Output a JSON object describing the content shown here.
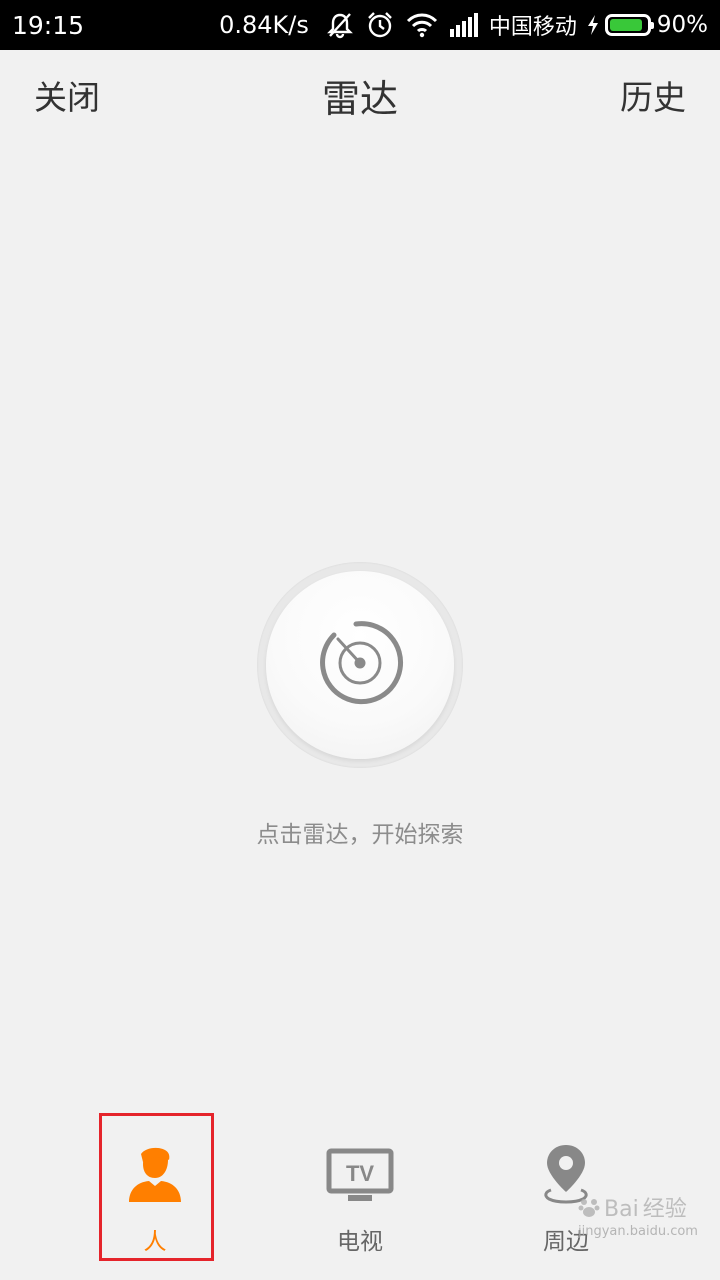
{
  "status_bar": {
    "time": "19:15",
    "speed": "0.84K/s",
    "carrier": "中国移动",
    "battery_percent": "90%",
    "battery_level": 0.9,
    "icons": [
      "muted-vibrate-icon",
      "alarm-icon",
      "wifi-icon",
      "signal-icon",
      "charging-icon",
      "battery-icon"
    ]
  },
  "header": {
    "close_label": "关闭",
    "title": "雷达",
    "history_label": "历史"
  },
  "radar": {
    "icon": "radar-icon",
    "hint": "点击雷达，开始探索"
  },
  "tabs": [
    {
      "label": "人",
      "icon": "person-icon",
      "active": true
    },
    {
      "label": "电视",
      "icon": "tv-icon",
      "active": false
    },
    {
      "label": "周边",
      "icon": "location-pin-icon",
      "active": false
    }
  ],
  "tv_icon_text": "TV",
  "colors": {
    "accent": "#ff7f00",
    "highlight": "#e5242b",
    "background": "#f1f1f1",
    "battery": "#39c839"
  },
  "watermark": {
    "brand": "Bai",
    "text": "经验",
    "url": "jingyan.baidu.com"
  }
}
